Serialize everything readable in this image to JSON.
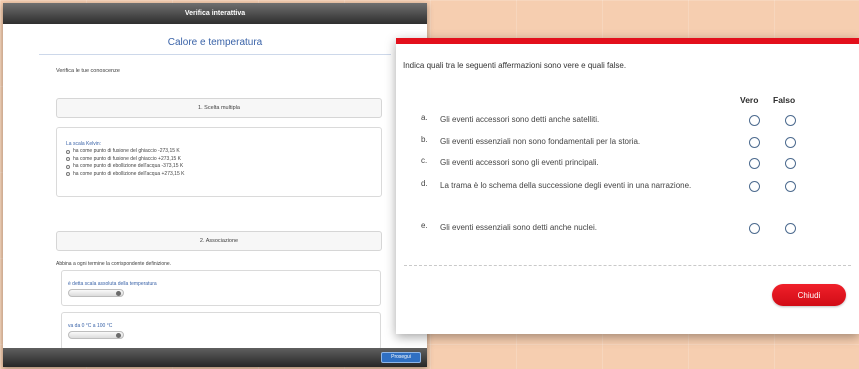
{
  "back_window": {
    "titlebar": "Verifica interattiva",
    "page_title": "Calore e temperatura",
    "intro": "Verifica le tue conoscenze",
    "section1": {
      "header": "1. Scelta multipla",
      "question": "La scala Kelvin:",
      "options": [
        "ha come punto di fusione del ghiaccio -273,15 K",
        "ha come punto di fusione del ghiaccio +273,15 K",
        "ha come punto di ebollizione dell'acqua -373,15 K",
        "ha come punto di ebollizione dell'acqua +273,15 K"
      ]
    },
    "section2": {
      "header": "2. Associazione",
      "instruction": "Abbina a ogni termine la corrispondente definizione.",
      "items": [
        {
          "label": "è detta scala assoluta della temperatura"
        },
        {
          "label": "va da 0 °C a 100 °C"
        }
      ]
    },
    "bottom_button": "Prosegui"
  },
  "dialog": {
    "instruction": "Indica quali tra le seguenti affermazioni sono vere e quali false.",
    "columns": {
      "true_label": "Vero",
      "false_label": "Falso"
    },
    "statements": [
      {
        "letter": "a.",
        "text": "Gli eventi accessori sono detti anche satelliti."
      },
      {
        "letter": "b.",
        "text": "Gli eventi essenziali non sono fondamentali per la storia."
      },
      {
        "letter": "c.",
        "text": "Gli eventi accessori sono gli eventi principali."
      },
      {
        "letter": "d.",
        "text": "La trama è lo schema della successione degli eventi in una narrazione."
      },
      {
        "letter": "e.",
        "text": "Gli eventi essenziali sono detti anche nuclei."
      }
    ],
    "close_label": "Chiudi",
    "accent_color": "#e3101c"
  }
}
